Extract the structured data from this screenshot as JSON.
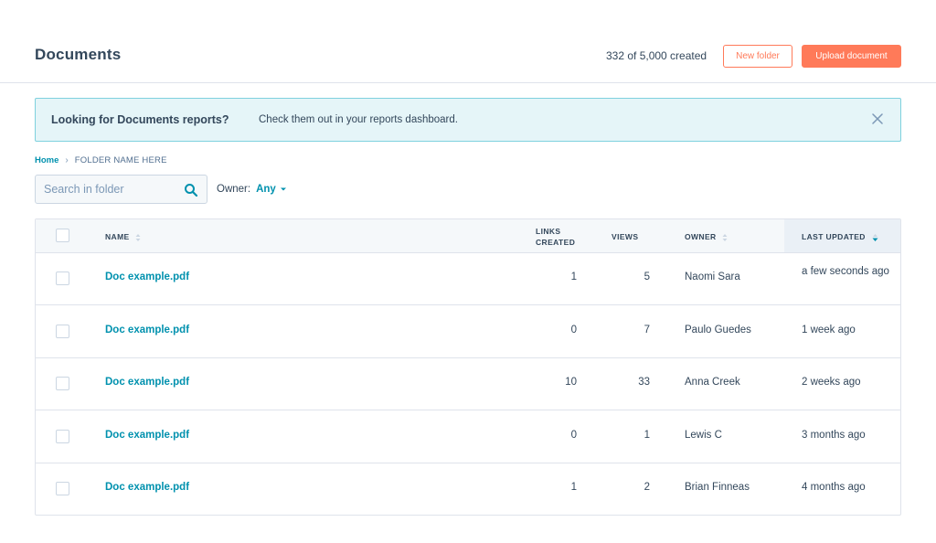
{
  "header": {
    "title": "Documents",
    "usage": "332 of 5,000 created",
    "new_folder_label": "New folder",
    "upload_label": "Upload document"
  },
  "alert": {
    "title": "Looking for Documents reports?",
    "body": "Check them out in your reports dashboard.",
    "close_icon": "close-icon"
  },
  "breadcrumb": {
    "home": "Home",
    "separator": "›",
    "current": "FOLDER NAME HERE"
  },
  "filters": {
    "search_placeholder": "Search in folder",
    "owner_label": "Owner:",
    "owner_value": "Any"
  },
  "table": {
    "columns": {
      "name": "NAME",
      "links_line1": "LINKS",
      "links_line2": "CREATED",
      "views": "VIEWS",
      "owner": "OWNER",
      "last_updated": "LAST UPDATED"
    },
    "rows": [
      {
        "name": "Doc example.pdf",
        "links": "1",
        "views": "5",
        "owner": "Naomi Sara",
        "updated": "a few seconds ago"
      },
      {
        "name": "Doc example.pdf",
        "links": "0",
        "views": "7",
        "owner": "Paulo Guedes",
        "updated": "1 week ago"
      },
      {
        "name": "Doc example.pdf",
        "links": "10",
        "views": "33",
        "owner": "Anna Creek",
        "updated": "2 weeks ago"
      },
      {
        "name": "Doc example.pdf",
        "links": "0",
        "views": "1",
        "owner": "Lewis C",
        "updated": "3 months ago"
      },
      {
        "name": "Doc example.pdf",
        "links": "1",
        "views": "2",
        "owner": "Brian Finneas",
        "updated": "4 months ago"
      }
    ]
  },
  "colors": {
    "accent": "#ff7a59",
    "link": "#0091ae",
    "text": "#33475b",
    "alert_bg": "#e5f5f8",
    "alert_border": "#7fd1de"
  }
}
